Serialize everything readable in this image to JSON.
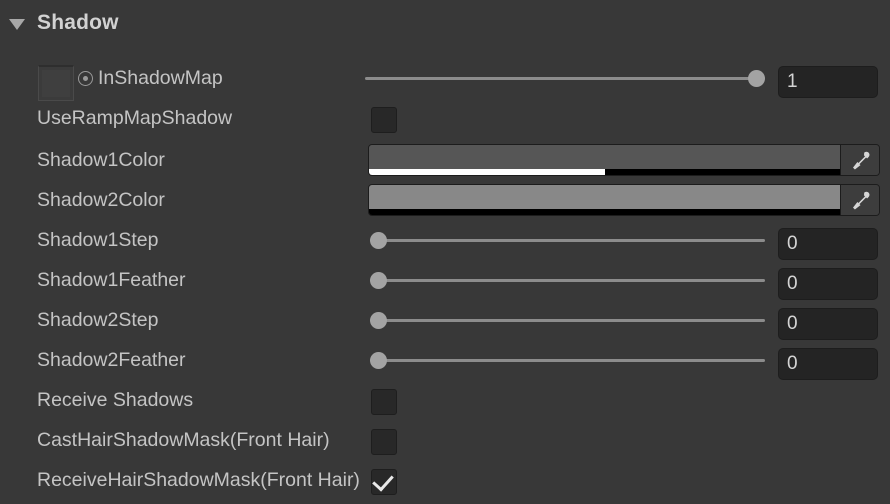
{
  "header": {
    "title": "Shadow",
    "foldout_state": "expanded",
    "arrow_icon": "triangle-down-icon"
  },
  "colors": {
    "panel_background": "#383838",
    "label_text": "#c4c4c4",
    "header_text": "#d2d2d2",
    "field_background": "#242424",
    "slider_handle": "#a3a3a3",
    "slider_track": "#8c8c8c",
    "checkbox_background": "#282828",
    "checkmark": "#e8e8e8"
  },
  "rows": {
    "in_shadow_map": {
      "label": "InShadowMap",
      "texture_slot_name": "texture-slot",
      "icon": "radio-target-icon",
      "slider_value": 1,
      "slider_min": 0,
      "slider_max": 1,
      "slider_percent": 100,
      "number_value": "1"
    },
    "use_ramp_map_shadow": {
      "label": "UseRampMapShadow",
      "checked": false
    },
    "shadow1_color": {
      "label": "Shadow1Color",
      "swatch_color": "#565656",
      "alpha_percent": 50,
      "eyedropper_icon": "eyedropper-icon"
    },
    "shadow2_color": {
      "label": "Shadow2Color",
      "swatch_color": "#888888",
      "alpha_percent": 0,
      "eyedropper_icon": "eyedropper-icon"
    },
    "shadow1_step": {
      "label": "Shadow1Step",
      "slider_value": 0,
      "slider_percent": 0,
      "number_value": "0"
    },
    "shadow1_feather": {
      "label": "Shadow1Feather",
      "slider_value": 0,
      "slider_percent": 0,
      "number_value": "0"
    },
    "shadow2_step": {
      "label": "Shadow2Step",
      "slider_value": 0,
      "slider_percent": 0,
      "number_value": "0"
    },
    "shadow2_feather": {
      "label": "Shadow2Feather",
      "slider_value": 0,
      "slider_percent": 0,
      "number_value": "0"
    },
    "receive_shadows": {
      "label": "Receive Shadows",
      "checked": false
    },
    "cast_hair_shadow_mask": {
      "label": "CastHairShadowMask(Front Hair)",
      "checked": false
    },
    "receive_hair_shadow_mask": {
      "label": "ReceiveHairShadowMask(Front Hair)",
      "checked": true
    }
  }
}
